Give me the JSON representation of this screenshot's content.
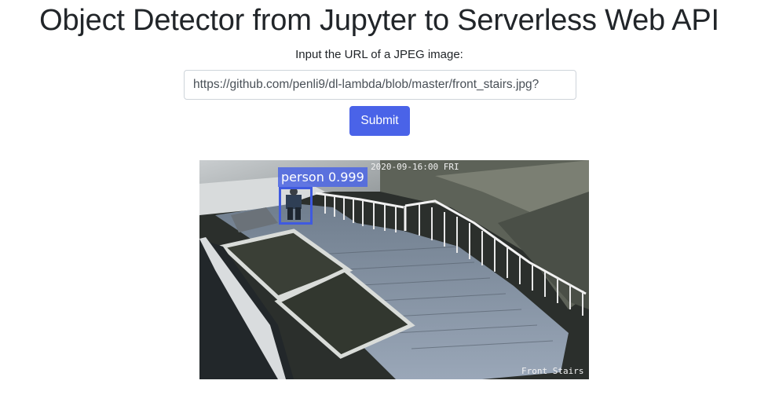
{
  "page": {
    "title": "Object Detector from Jupyter to Serverless Web API",
    "prompt": "Input the URL of a JPEG image:"
  },
  "form": {
    "url_value": "https://github.com/penli9/dl-lambda/blob/master/front_stairs.jpg?",
    "submit_label": "Submit"
  },
  "result": {
    "camera_timestamp": "2020-09-16:00 FRI",
    "camera_name": "Front Stairs",
    "detection": {
      "label": "person",
      "score": "0.999",
      "color": "#3f5ae0"
    }
  }
}
